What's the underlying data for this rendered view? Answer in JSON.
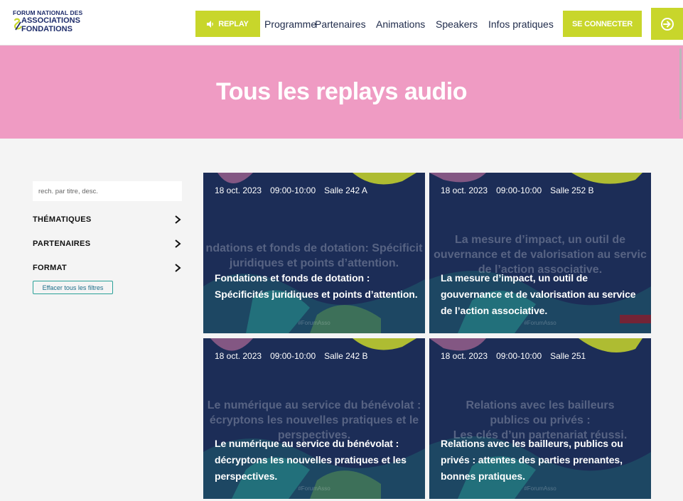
{
  "header": {
    "logo": {
      "line1": "FORUM NATIONAL DES",
      "line2": "ASSOCIATIONS",
      "line3": "FONDATIONS"
    },
    "replay_label": "REPLAY",
    "nav": [
      {
        "label": "Programme"
      },
      {
        "label": "Partenaires"
      },
      {
        "label": "Animations"
      },
      {
        "label": "Speakers"
      },
      {
        "label": "Infos pratiques"
      }
    ],
    "login_label": "SE CONNECTER",
    "colors": {
      "accent": "#c8d62b",
      "hero": "#ef9bc3",
      "card": "#1c2d57",
      "navy": "#1f2d6b"
    }
  },
  "hero": {
    "title": "Tous les replays audio"
  },
  "sidebar": {
    "search_placeholder": "rech. par titre, desc.",
    "filters": [
      {
        "label": "THÉMATIQUES"
      },
      {
        "label": "PARTENAIRES"
      },
      {
        "label": "FORMAT"
      }
    ],
    "clear_label": "Effacer tous les filtres"
  },
  "cards": [
    {
      "date": "18 oct. 2023",
      "time": "09:00-10:00",
      "room": "Salle 242 A",
      "title": "Fondations et fonds de dotation : Spécificités juridiques et points d’attention.",
      "ghost": [
        "ndations et fonds de dotation: Spécificit",
        "juridiques et points d’attention."
      ],
      "tag": "#ForumAsso"
    },
    {
      "date": "18 oct. 2023",
      "time": "09:00-10:00",
      "room": "Salle 252 B",
      "title": "La mesure d’impact, un outil de gouvernance et de valorisation au service de l’action associative.",
      "ghost": [
        "La mesure d’impact, un outil de",
        "ouvernance et de valorisation au servic",
        "de l’action associative."
      ],
      "tag": "#ForumAsso"
    },
    {
      "date": "18 oct. 2023",
      "time": "09:00-10:00",
      "room": "Salle 242 B",
      "title": "Le numérique au service du bénévolat : décryptons les nouvelles pratiques et les perspectives.",
      "ghost": [
        "Le numérique au service du bénévolat :",
        "écryptons les nouvelles pratiques et le",
        "perspectives."
      ],
      "tag": "#ForumAsso"
    },
    {
      "date": "18 oct. 2023",
      "time": "09:00-10:00",
      "room": "Salle 251",
      "title": "Relations avec les bailleurs, publics ou privés : attentes des parties prenantes, bonnes pratiques.",
      "ghost": [
        "Relations avec les bailleurs",
        "publics ou privés :",
        "Les clés d’un partenariat réussi."
      ],
      "tag": "#ForumAsso"
    }
  ]
}
